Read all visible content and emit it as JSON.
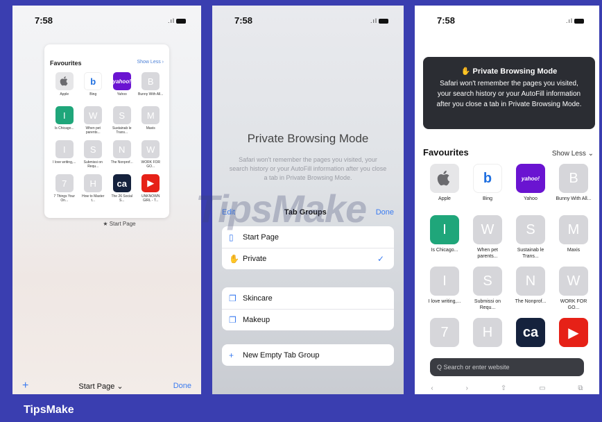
{
  "status": {
    "time": "7:58",
    "signal": ".ıl"
  },
  "panel1": {
    "card_title": "Favourites",
    "card_less": "Show Less ›",
    "tiles": [
      {
        "letter": "",
        "label": "Apple",
        "bg": "#e6e6e8",
        "icon": "apple-logo"
      },
      {
        "letter": "b",
        "label": "Bing",
        "bg": "#ffffff",
        "icon": "bing-logo",
        "fg": "#1f6fe0"
      },
      {
        "letter": "yahoo!",
        "label": "Yahoo",
        "bg": "#6a14d1"
      },
      {
        "letter": "B",
        "label": "Bunny With All...",
        "bg": "#d8d8dc"
      },
      {
        "letter": "I",
        "label": "Is Chicago...",
        "bg": "#1fa67a"
      },
      {
        "letter": "W",
        "label": "When pet parents...",
        "bg": "#d8d8dc"
      },
      {
        "letter": "S",
        "label": "Sustainab le Trans...",
        "bg": "#d8d8dc"
      },
      {
        "letter": "M",
        "label": "Maxis",
        "bg": "#d8d8dc"
      },
      {
        "letter": "I",
        "label": "I love writing,...",
        "bg": "#d8d8dc"
      },
      {
        "letter": "S",
        "label": "Submissi on Requ...",
        "bg": "#d8d8dc"
      },
      {
        "letter": "N",
        "label": "The Nonprof...",
        "bg": "#d8d8dc"
      },
      {
        "letter": "W",
        "label": "WORK FOR GO...",
        "bg": "#d8d8dc"
      },
      {
        "letter": "7",
        "label": "7 Things Your On...",
        "bg": "#d8d8dc"
      },
      {
        "letter": "H",
        "label": "How to Master t...",
        "bg": "#d8d8dc"
      },
      {
        "letter": "ca",
        "label": "The 26 Social S...",
        "bg": "#15223d"
      },
      {
        "letter": "▶",
        "label": "UNKNOWN GIRL - T...",
        "bg": "#e62117"
      }
    ],
    "caption": "★ Start Page",
    "bottom": {
      "plus": "+",
      "start": "Start Page ⌄",
      "done": "Done"
    }
  },
  "panel2": {
    "title": "Private Browsing Mode",
    "body": "Safari won't remember the pages you visited, your search history or your AutoFill information after you close a tab in Private Browsing Mode.",
    "sheet": {
      "edit": "Edit",
      "title": "Tab Groups",
      "done": "Done"
    },
    "group1": [
      {
        "icon": "▯",
        "label": "Start Page",
        "checked": ""
      },
      {
        "icon": "✋",
        "label": "Private",
        "checked": "✓"
      }
    ],
    "group2": [
      {
        "icon": "❐",
        "label": "Skincare"
      },
      {
        "icon": "❐",
        "label": "Makeup"
      }
    ],
    "new_group": {
      "icon": "+",
      "label": "New Empty Tab Group"
    }
  },
  "panel3": {
    "banner_title": "✋ Private Browsing Mode",
    "banner_text": "Safari won't remember the pages you visited, your search history or your AutoFill information after you close a tab in Private Browsing Mode.",
    "fav_title": "Favourites",
    "fav_less": "Show Less ⌄",
    "tiles": [
      {
        "letter": "",
        "label": "Apple",
        "bg": "#e6e6e8"
      },
      {
        "letter": "b",
        "label": "Bing",
        "bg": "#ffffff",
        "fg": "#1f6fe0"
      },
      {
        "letter": "yahoo!",
        "label": "Yahoo",
        "bg": "#6a14d1"
      },
      {
        "letter": "B",
        "label": "Bunny With All...",
        "bg": "#d6d6da"
      },
      {
        "letter": "I",
        "label": "Is Chicago...",
        "bg": "#1fa67a"
      },
      {
        "letter": "W",
        "label": "When pet parents...",
        "bg": "#d6d6da"
      },
      {
        "letter": "S",
        "label": "Sustainab le Trans...",
        "bg": "#d6d6da"
      },
      {
        "letter": "M",
        "label": "Maxis",
        "bg": "#d6d6da"
      },
      {
        "letter": "I",
        "label": "I love writing,...",
        "bg": "#d6d6da"
      },
      {
        "letter": "S",
        "label": "Submissi on Requ...",
        "bg": "#d6d6da"
      },
      {
        "letter": "N",
        "label": "The Nonprof...",
        "bg": "#d6d6da"
      },
      {
        "letter": "W",
        "label": "WORK FOR GO...",
        "bg": "#d6d6da"
      },
      {
        "letter": "7",
        "label": "",
        "bg": "#d6d6da"
      },
      {
        "letter": "H",
        "label": "",
        "bg": "#d6d6da"
      },
      {
        "letter": "ca",
        "label": "",
        "bg": "#15223d"
      },
      {
        "letter": "▶",
        "label": "",
        "bg": "#e62117"
      }
    ],
    "search_placeholder": "Q  Search or enter website",
    "nav": [
      "‹",
      "›",
      "⇧",
      "▭",
      "⧉"
    ]
  },
  "watermark": "TipsMake",
  "brand": "TipsMake"
}
